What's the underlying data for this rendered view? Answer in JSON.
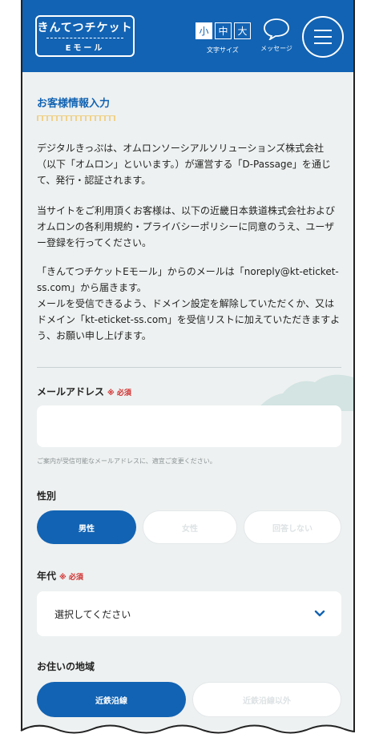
{
  "header": {
    "logo_line1": "きんてつチケット",
    "logo_line2": "Eモール",
    "font_sizes": [
      "小",
      "中",
      "大"
    ],
    "font_size_selected": "小",
    "font_size_label": "文字サイズ",
    "message_label": "メッセージ",
    "brand_color": "#1263b3"
  },
  "main": {
    "title": "お客様情報入力",
    "paragraphs": [
      "デジタルきっぷは、オムロンソーシアルソリューションズ株式会社（以下「オムロン」といいます。）が運営する「D-Passage」を通じて、発行・認証されます。",
      "当サイトをご利用頂くお客様は、以下の近畿日本鉄道株式会社およびオムロンの各利用規約・プライバシーポリシーに同意のうえ、ユーザー登録を行ってください。",
      "「きんてつチケットEモール」からのメールは「noreply@kt-eticket-ss.com」から届きます。",
      "メールを受信できるよう、ドメイン設定を解除していただくか、又はドメイン「kt-eticket-ss.com」を受信リストに加えていただきますよう、お願い申し上げます。"
    ]
  },
  "form": {
    "email": {
      "label": "メールアドレス",
      "required": "※ 必須",
      "value": "",
      "hint": "ご案内が受信可能なメールアドレスに、適宜ご変更ください。"
    },
    "gender": {
      "label": "性別",
      "options": [
        "男性",
        "女性",
        "回答しない"
      ],
      "selected": "男性"
    },
    "age": {
      "label": "年代",
      "required": "※ 必須",
      "placeholder": "選択してください"
    },
    "region": {
      "label": "お住いの地域",
      "options": [
        "近鉄沿線",
        "近鉄沿線以外"
      ],
      "selected": "近鉄沿線"
    }
  }
}
